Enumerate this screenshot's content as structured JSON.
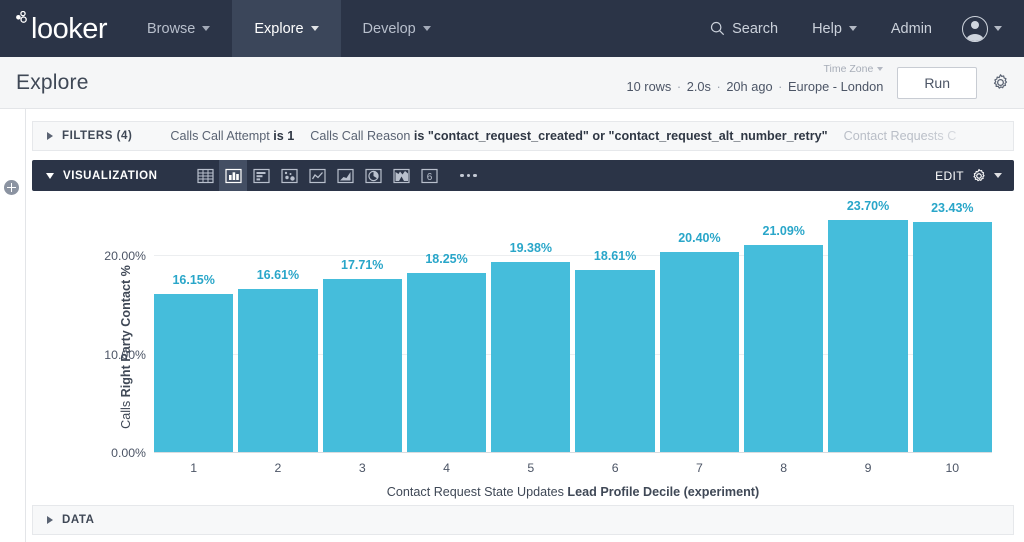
{
  "topnav": {
    "logo": "looker",
    "items": [
      {
        "label": "Browse",
        "icon": "chevron-down-icon"
      },
      {
        "label": "Explore",
        "icon": "chevron-down-icon"
      },
      {
        "label": "Develop",
        "icon": "chevron-down-icon"
      }
    ],
    "active_item": "Explore",
    "search_label": "Search",
    "search_icon": "search-icon",
    "help_label": "Help",
    "admin_label": "Admin",
    "avatar_icon": "user-avatar-icon",
    "bg_color": "#2b3447",
    "active_bg_color": "#3b465a"
  },
  "explore_header": {
    "title": "Explore",
    "timezone_label": "Time Zone",
    "meta": {
      "rows": "10 rows",
      "duration": "2.0s",
      "age": "20h ago",
      "timezone": "Europe - London",
      "separator": "·"
    },
    "run_label": "Run",
    "settings_icon": "gear-icon"
  },
  "left_rail": {
    "add_icon": "add-circle-icon"
  },
  "filters": {
    "label": "FILTERS (4)",
    "expander_icon": "triangle-right-icon",
    "items": [
      {
        "field": "Calls Call Attempt ",
        "value": "is 1",
        "faded": false
      },
      {
        "field": "Calls Call Reason ",
        "value": "is \"contact_request_created\" or \"contact_request_alt_number_retry\"",
        "faded": false
      },
      {
        "field": "Contact Requests C",
        "value": "",
        "faded": true
      }
    ]
  },
  "visualization": {
    "label": "VISUALIZATION",
    "expander_icon": "triangle-down-icon",
    "chart_types": [
      {
        "name": "table-chart-icon",
        "active": false
      },
      {
        "name": "column-chart-icon",
        "active": true
      },
      {
        "name": "bar-chart-icon",
        "active": false
      },
      {
        "name": "scatter-chart-icon",
        "active": false
      },
      {
        "name": "line-chart-icon",
        "active": false
      },
      {
        "name": "area-chart-icon",
        "active": false
      },
      {
        "name": "pie-chart-icon",
        "active": false
      },
      {
        "name": "map-chart-icon",
        "active": false
      },
      {
        "name": "single-value-chart-icon",
        "active": false,
        "glyph": "6"
      }
    ],
    "overflow_icon": "more-options-icon",
    "edit_label": "EDIT",
    "edit_gear_icon": "gear-icon",
    "edit_caret_icon": "caret-down-icon"
  },
  "data_section": {
    "label": "DATA",
    "expander_icon": "triangle-right-icon"
  },
  "chart_data": {
    "type": "bar",
    "title": "",
    "xlabel_prefix": "Contact Request State Updates ",
    "xlabel_bold": "Lead Profile Decile (experiment)",
    "ylabel_prefix": "Calls ",
    "ylabel_bold": "Right Party Contact %",
    "categories": [
      "1",
      "2",
      "3",
      "4",
      "5",
      "6",
      "7",
      "8",
      "9",
      "10"
    ],
    "values": [
      16.15,
      16.61,
      17.71,
      18.25,
      19.38,
      18.61,
      20.4,
      21.09,
      23.7,
      23.43
    ],
    "data_labels": [
      "16.15%",
      "16.61%",
      "17.71%",
      "18.25%",
      "19.38%",
      "18.61%",
      "20.40%",
      "21.09%",
      "23.70%",
      "23.43%"
    ],
    "ytick_labels": [
      "0.00%",
      "10.00%",
      "20.00%"
    ],
    "ytick_values": [
      0,
      10,
      20
    ],
    "ylim": [
      0,
      26
    ],
    "grid": true,
    "legend": "none",
    "bar_color": "#45bddb",
    "label_color": "#29a6c9"
  }
}
